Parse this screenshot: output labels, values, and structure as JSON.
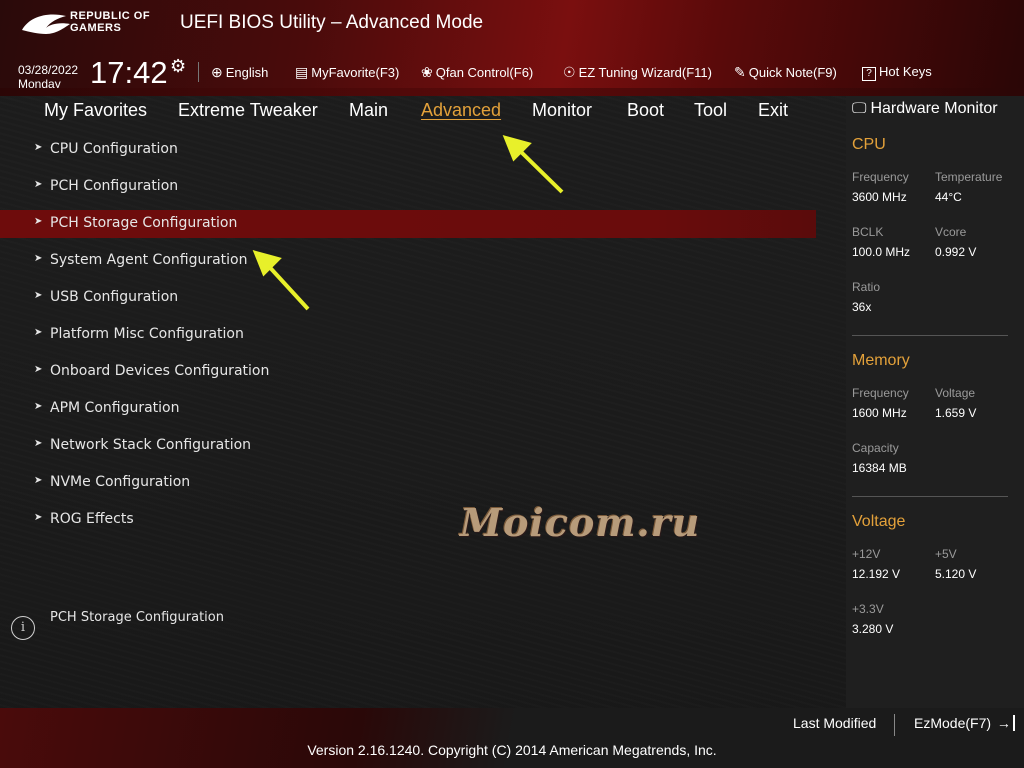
{
  "header": {
    "logo_line1": "REPUBLIC OF",
    "logo_line2": "GAMERS",
    "title": "UEFI BIOS Utility – Advanced Mode",
    "date": "03/28/2022",
    "weekday": "Monday",
    "time": "17:42",
    "items": [
      {
        "icon": "globe-icon",
        "glyph": "⊕",
        "label": "English"
      },
      {
        "icon": "favorite-icon",
        "glyph": "▤",
        "label": "MyFavorite(F3)"
      },
      {
        "icon": "fan-icon",
        "glyph": "❀",
        "label": "Qfan Control(F6)"
      },
      {
        "icon": "bulb-icon",
        "glyph": "☉",
        "label": "EZ Tuning Wizard(F11)"
      },
      {
        "icon": "note-icon",
        "glyph": "✎",
        "label": "Quick Note(F9)"
      },
      {
        "icon": "help-icon",
        "glyph": "?",
        "label": "Hot Keys"
      }
    ]
  },
  "tabs": [
    "My Favorites",
    "Extreme Tweaker",
    "Main",
    "Advanced",
    "Monitor",
    "Boot",
    "Tool",
    "Exit"
  ],
  "active_tab": "Advanced",
  "menu": {
    "selected": "PCH Storage Configuration",
    "items": [
      "CPU Configuration",
      "PCH Configuration",
      "PCH Storage Configuration",
      "System Agent Configuration",
      "USB Configuration",
      "Platform Misc Configuration",
      "Onboard Devices Configuration",
      "APM Configuration",
      "Network Stack Configuration",
      "NVMe Configuration",
      "ROG Effects"
    ]
  },
  "info": {
    "text": "PCH Storage Configuration"
  },
  "watermark": "Moicom.ru",
  "hardware_monitor": {
    "title": "Hardware Monitor",
    "cpu": {
      "title": "CPU",
      "frequency_label": "Frequency",
      "frequency": "3600 MHz",
      "temperature_label": "Temperature",
      "temperature": "44°C",
      "bclk_label": "BCLK",
      "bclk": "100.0 MHz",
      "vcore_label": "Vcore",
      "vcore": "0.992 V",
      "ratio_label": "Ratio",
      "ratio": "36x"
    },
    "memory": {
      "title": "Memory",
      "frequency_label": "Frequency",
      "frequency": "1600 MHz",
      "voltage_label": "Voltage",
      "voltage": "1.659 V",
      "capacity_label": "Capacity",
      "capacity": "16384 MB"
    },
    "voltage": {
      "title": "Voltage",
      "v12_label": "+12V",
      "v12": "12.192 V",
      "v5_label": "+5V",
      "v5": "5.120 V",
      "v33_label": "+3.3V",
      "v33": "3.280 V"
    }
  },
  "footer": {
    "last_modified": "Last Modified",
    "ezmode": "EzMode(F7)",
    "version": "Version 2.16.1240. Copyright (C) 2014 American Megatrends, Inc."
  },
  "colors": {
    "accent": "#e3a13a",
    "selected_row": "#6e0c0c",
    "highlight_arrow": "#e8f02a"
  }
}
